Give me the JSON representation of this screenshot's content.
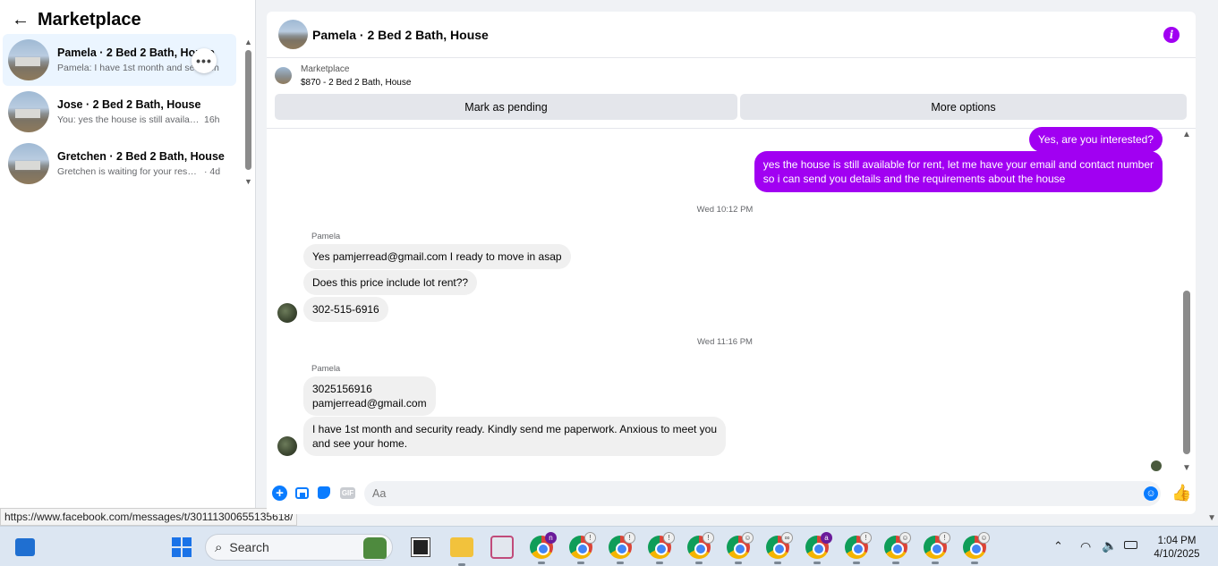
{
  "sidebar": {
    "title": "Marketplace",
    "conversations": [
      {
        "name": "Pamela · 2 Bed 2 Bath, House",
        "snippet": "Pamela: I have 1st month and sec",
        "time": "· 3h"
      },
      {
        "name": "Jose · 2 Bed 2 Bath, House",
        "snippet": "You: yes the house is still availabl...",
        "time": "16h"
      },
      {
        "name": "Gretchen · 2 Bed 2 Bath, House",
        "snippet": "Gretchen is waiting for your respo...",
        "time": "· 4d"
      }
    ]
  },
  "status_bar": {
    "url": "https://www.facebook.com/messages/t/30111300655135618/"
  },
  "chat": {
    "title": "Pamela · 2 Bed 2 Bath, House",
    "listing": {
      "source": "Marketplace",
      "price_title": "$870 - 2 Bed 2 Bath, House",
      "pending_label": "Mark as pending",
      "more_label": "More options"
    },
    "messages": {
      "out_1": "Yes, are you interested?",
      "out_2_line1": "yes the house is still available for rent, let me have your email  and contact number",
      "out_2_line2": "so i can send you details and the requirements about the house",
      "ts_1": "Wed 10:12 PM",
      "sender_1": "Pamela",
      "in_1": "Yes pamjerread@gmail.com I ready to move in asap",
      "in_2": "Does this price include lot rent??",
      "in_3": "302-515-6916",
      "ts_2": "Wed 11:16 PM",
      "sender_2": "Pamela",
      "in_4_line1": "3025156916",
      "in_4_line2": "pamjerread@gmail.com",
      "in_5_line1": "I have 1st month and security ready. Kindly send me paperwork. Anxious to meet you",
      "in_5_line2": "and see your home."
    },
    "composer": {
      "placeholder": "Aa",
      "gif_label": "GIF"
    }
  },
  "taskbar": {
    "search_label": "Search",
    "time": "1:04 PM",
    "date": "4/10/2025"
  },
  "colors": {
    "accent": "#a100f2",
    "messenger_blue": "#0a7cff"
  }
}
